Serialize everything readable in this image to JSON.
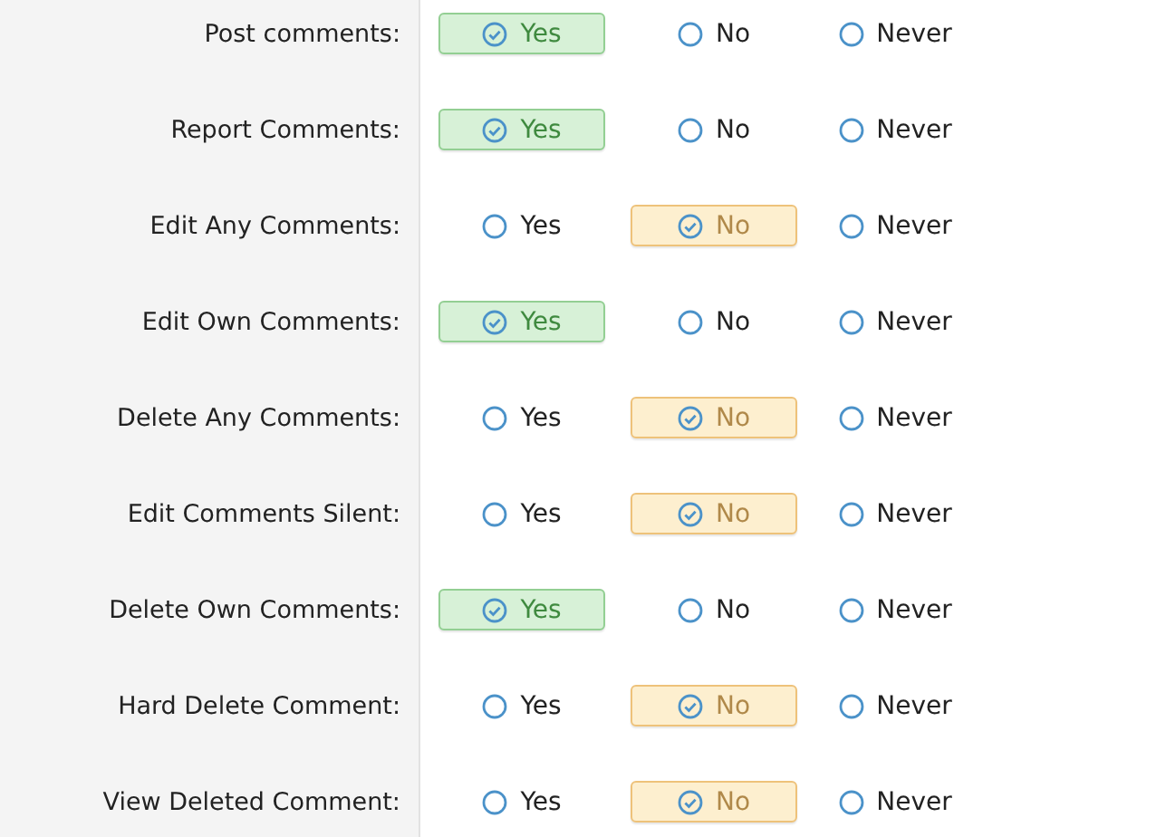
{
  "permissions": [
    {
      "label": "Post comments:",
      "options": [
        {
          "label": "Yes",
          "kind": "yes",
          "selected": true
        },
        {
          "label": "No",
          "kind": "no",
          "selected": false
        },
        {
          "label": "Never",
          "kind": "never",
          "selected": false
        }
      ]
    },
    {
      "label": "Report Comments:",
      "options": [
        {
          "label": "Yes",
          "kind": "yes",
          "selected": true
        },
        {
          "label": "No",
          "kind": "no",
          "selected": false
        },
        {
          "label": "Never",
          "kind": "never",
          "selected": false
        }
      ]
    },
    {
      "label": "Edit Any Comments:",
      "options": [
        {
          "label": "Yes",
          "kind": "yes",
          "selected": false
        },
        {
          "label": "No",
          "kind": "no",
          "selected": true
        },
        {
          "label": "Never",
          "kind": "never",
          "selected": false
        }
      ]
    },
    {
      "label": "Edit Own Comments:",
      "options": [
        {
          "label": "Yes",
          "kind": "yes",
          "selected": true
        },
        {
          "label": "No",
          "kind": "no",
          "selected": false
        },
        {
          "label": "Never",
          "kind": "never",
          "selected": false
        }
      ]
    },
    {
      "label": "Delete Any Comments:",
      "options": [
        {
          "label": "Yes",
          "kind": "yes",
          "selected": false
        },
        {
          "label": "No",
          "kind": "no",
          "selected": true
        },
        {
          "label": "Never",
          "kind": "never",
          "selected": false
        }
      ]
    },
    {
      "label": "Edit Comments Silent:",
      "options": [
        {
          "label": "Yes",
          "kind": "yes",
          "selected": false
        },
        {
          "label": "No",
          "kind": "no",
          "selected": true
        },
        {
          "label": "Never",
          "kind": "never",
          "selected": false
        }
      ]
    },
    {
      "label": "Delete Own Comments:",
      "options": [
        {
          "label": "Yes",
          "kind": "yes",
          "selected": true
        },
        {
          "label": "No",
          "kind": "no",
          "selected": false
        },
        {
          "label": "Never",
          "kind": "never",
          "selected": false
        }
      ]
    },
    {
      "label": "Hard Delete Comment:",
      "options": [
        {
          "label": "Yes",
          "kind": "yes",
          "selected": false
        },
        {
          "label": "No",
          "kind": "no",
          "selected": true
        },
        {
          "label": "Never",
          "kind": "never",
          "selected": false
        }
      ]
    },
    {
      "label": "View Deleted Comment:",
      "options": [
        {
          "label": "Yes",
          "kind": "yes",
          "selected": false
        },
        {
          "label": "No",
          "kind": "no",
          "selected": true
        },
        {
          "label": "Never",
          "kind": "never",
          "selected": false
        }
      ]
    }
  ]
}
